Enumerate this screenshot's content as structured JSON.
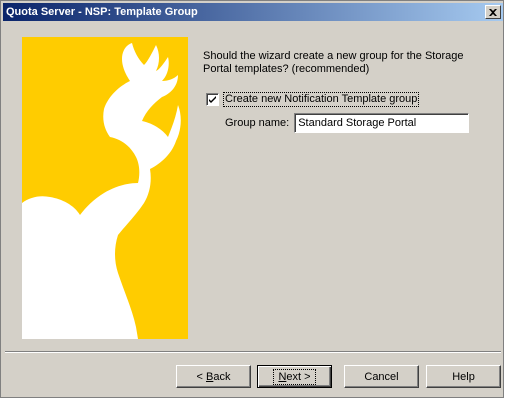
{
  "window": {
    "title": "Quota Server - NSP: Template Group"
  },
  "question": {
    "text": "Should the wizard create a new group for the Storage Portal templates? (recommended)"
  },
  "create_group": {
    "label": "Create new Notification Template group",
    "checked": true
  },
  "group_name": {
    "label": "Group name:",
    "value": "Standard Storage Portal"
  },
  "buttons": {
    "back": {
      "prefix": "< ",
      "mnemonic": "B",
      "rest": "ack"
    },
    "next": {
      "mnemonic": "N",
      "rest": "ext >"
    },
    "cancel": "Cancel",
    "help": "Help"
  },
  "banner": {
    "icon": "deer-head-silhouette",
    "background_color": "#ffcc00",
    "shape_color": "#ffffff"
  },
  "colors": {
    "titlebar_start": "#0a246a",
    "titlebar_end": "#a6caf0",
    "dialog_face": "#d4d0c8"
  }
}
